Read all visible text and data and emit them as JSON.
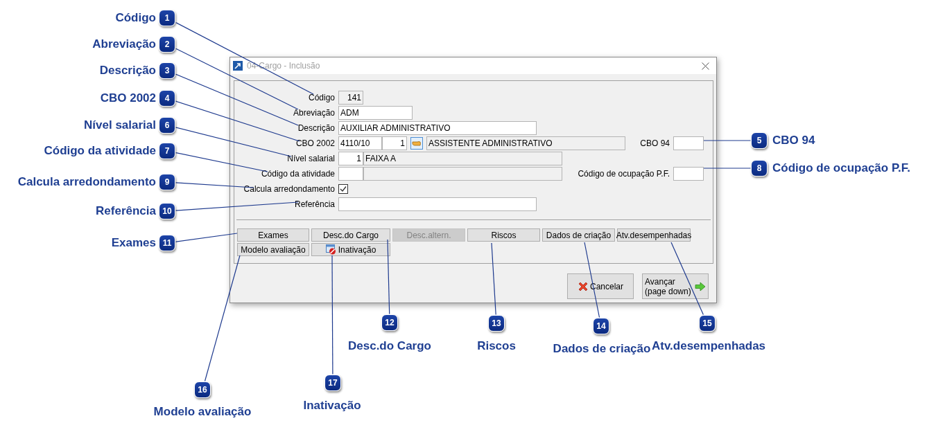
{
  "window": {
    "title": "04-Cargo - Inclusão"
  },
  "fields": {
    "codigo": {
      "label": "Código",
      "value": "141"
    },
    "abreviacao": {
      "label": "Abreviação",
      "value": "ADM"
    },
    "descricao": {
      "label": "Descrição",
      "value": "AUXILIAR ADMINISTRATIVO"
    },
    "cbo_2002": {
      "label": "CBO 2002",
      "code": "4110/10",
      "sequence": "1",
      "description": "ASSISTENTE ADMINISTRATIVO"
    },
    "cbo_94": {
      "label": "CBO 94"
    },
    "nivel_salarial": {
      "label": "Nível salarial",
      "code": "1",
      "description": "FAIXA A"
    },
    "codigo_atividade": {
      "label": "Código da atividade"
    },
    "codigo_ocupacao_pf": {
      "label": "Código de ocupação P.F."
    },
    "calcula_arredondamento": {
      "label": "Calcula arredondamento",
      "checked": true
    },
    "referencia": {
      "label": "Referência"
    }
  },
  "option_buttons": [
    {
      "label": "Exames",
      "kind": "plain",
      "disabled": false
    },
    {
      "label": "Desc.do Cargo",
      "kind": "plain",
      "disabled": false
    },
    {
      "label": "Desc.altern.",
      "kind": "plain",
      "disabled": true
    },
    {
      "label": "Riscos",
      "kind": "plain",
      "disabled": false
    },
    {
      "label": "Dados de criação",
      "kind": "plain",
      "disabled": false
    },
    {
      "label": "Atv.desempenhadas",
      "kind": "plain",
      "disabled": false
    },
    {
      "label": "Modelo avaliação",
      "kind": "plain",
      "disabled": false
    },
    {
      "label": "Inativação",
      "kind": "icon",
      "disabled": false
    }
  ],
  "footer_buttons": [
    {
      "label": "Cancelar",
      "kind": "cancel"
    },
    {
      "label": "Avançar (page down)",
      "kind": "next"
    }
  ],
  "callouts": [
    {
      "number": "1",
      "label": "Código"
    },
    {
      "number": "2",
      "label": "Abreviação"
    },
    {
      "number": "3",
      "label": "Descrição"
    },
    {
      "number": "4",
      "label": "CBO 2002"
    },
    {
      "number": "5",
      "label": "CBO 94"
    },
    {
      "number": "6",
      "label": "Nível salarial"
    },
    {
      "number": "7",
      "label": "Código da atividade"
    },
    {
      "number": "8",
      "label": "Código de ocupação P.F."
    },
    {
      "number": "9",
      "label": "Calcula arredondamento"
    },
    {
      "number": "10",
      "label": "Referência"
    },
    {
      "number": "11",
      "label": "Exames"
    },
    {
      "number": "12",
      "label": "Desc.do Cargo"
    },
    {
      "number": "13",
      "label": "Riscos"
    },
    {
      "number": "14",
      "label": "Dados de criação"
    },
    {
      "number": "15",
      "label": "Atv.desempenhadas"
    },
    {
      "number": "16",
      "label": "Modelo avaliação"
    },
    {
      "number": "17",
      "label": "Inativação"
    }
  ]
}
